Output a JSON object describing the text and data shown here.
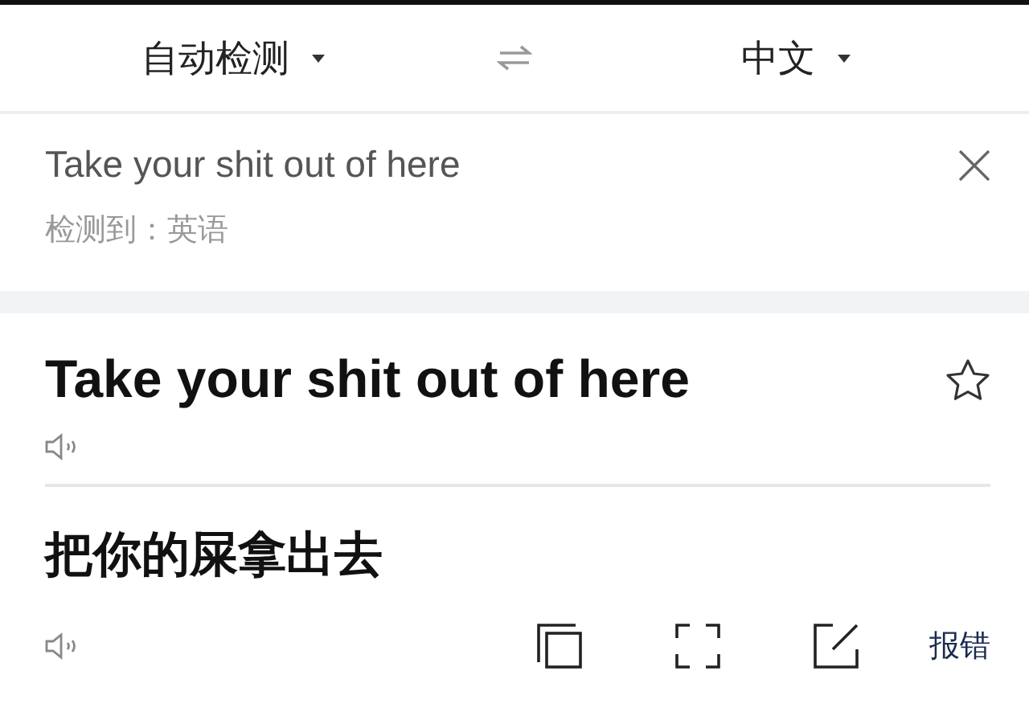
{
  "languages": {
    "source": "自动检测",
    "target": "中文"
  },
  "input": {
    "text": "Take your shit out of here",
    "detected": "检测到：英语"
  },
  "result": {
    "source_text": "Take your shit out of here",
    "starred": false,
    "translation": "把你的屎拿出去",
    "report": "报错"
  }
}
